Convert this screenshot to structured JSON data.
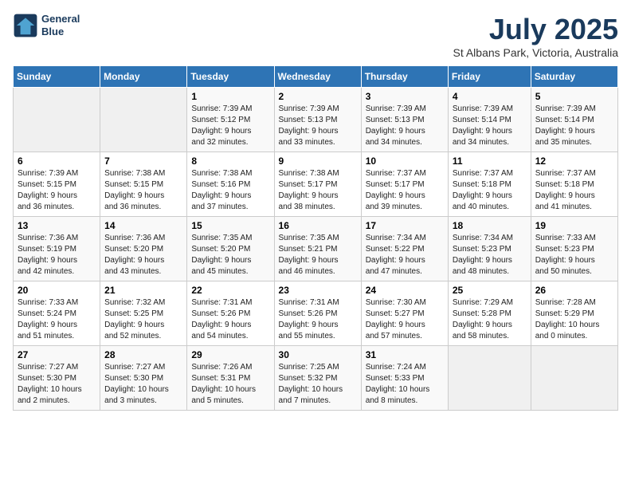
{
  "logo": {
    "line1": "General",
    "line2": "Blue"
  },
  "title": "July 2025",
  "subtitle": "St Albans Park, Victoria, Australia",
  "days_header": [
    "Sunday",
    "Monday",
    "Tuesday",
    "Wednesday",
    "Thursday",
    "Friday",
    "Saturday"
  ],
  "weeks": [
    [
      {
        "day": "",
        "content": ""
      },
      {
        "day": "",
        "content": ""
      },
      {
        "day": "1",
        "content": "Sunrise: 7:39 AM\nSunset: 5:12 PM\nDaylight: 9 hours\nand 32 minutes."
      },
      {
        "day": "2",
        "content": "Sunrise: 7:39 AM\nSunset: 5:13 PM\nDaylight: 9 hours\nand 33 minutes."
      },
      {
        "day": "3",
        "content": "Sunrise: 7:39 AM\nSunset: 5:13 PM\nDaylight: 9 hours\nand 34 minutes."
      },
      {
        "day": "4",
        "content": "Sunrise: 7:39 AM\nSunset: 5:14 PM\nDaylight: 9 hours\nand 34 minutes."
      },
      {
        "day": "5",
        "content": "Sunrise: 7:39 AM\nSunset: 5:14 PM\nDaylight: 9 hours\nand 35 minutes."
      }
    ],
    [
      {
        "day": "6",
        "content": "Sunrise: 7:39 AM\nSunset: 5:15 PM\nDaylight: 9 hours\nand 36 minutes."
      },
      {
        "day": "7",
        "content": "Sunrise: 7:38 AM\nSunset: 5:15 PM\nDaylight: 9 hours\nand 36 minutes."
      },
      {
        "day": "8",
        "content": "Sunrise: 7:38 AM\nSunset: 5:16 PM\nDaylight: 9 hours\nand 37 minutes."
      },
      {
        "day": "9",
        "content": "Sunrise: 7:38 AM\nSunset: 5:17 PM\nDaylight: 9 hours\nand 38 minutes."
      },
      {
        "day": "10",
        "content": "Sunrise: 7:37 AM\nSunset: 5:17 PM\nDaylight: 9 hours\nand 39 minutes."
      },
      {
        "day": "11",
        "content": "Sunrise: 7:37 AM\nSunset: 5:18 PM\nDaylight: 9 hours\nand 40 minutes."
      },
      {
        "day": "12",
        "content": "Sunrise: 7:37 AM\nSunset: 5:18 PM\nDaylight: 9 hours\nand 41 minutes."
      }
    ],
    [
      {
        "day": "13",
        "content": "Sunrise: 7:36 AM\nSunset: 5:19 PM\nDaylight: 9 hours\nand 42 minutes."
      },
      {
        "day": "14",
        "content": "Sunrise: 7:36 AM\nSunset: 5:20 PM\nDaylight: 9 hours\nand 43 minutes."
      },
      {
        "day": "15",
        "content": "Sunrise: 7:35 AM\nSunset: 5:20 PM\nDaylight: 9 hours\nand 45 minutes."
      },
      {
        "day": "16",
        "content": "Sunrise: 7:35 AM\nSunset: 5:21 PM\nDaylight: 9 hours\nand 46 minutes."
      },
      {
        "day": "17",
        "content": "Sunrise: 7:34 AM\nSunset: 5:22 PM\nDaylight: 9 hours\nand 47 minutes."
      },
      {
        "day": "18",
        "content": "Sunrise: 7:34 AM\nSunset: 5:23 PM\nDaylight: 9 hours\nand 48 minutes."
      },
      {
        "day": "19",
        "content": "Sunrise: 7:33 AM\nSunset: 5:23 PM\nDaylight: 9 hours\nand 50 minutes."
      }
    ],
    [
      {
        "day": "20",
        "content": "Sunrise: 7:33 AM\nSunset: 5:24 PM\nDaylight: 9 hours\nand 51 minutes."
      },
      {
        "day": "21",
        "content": "Sunrise: 7:32 AM\nSunset: 5:25 PM\nDaylight: 9 hours\nand 52 minutes."
      },
      {
        "day": "22",
        "content": "Sunrise: 7:31 AM\nSunset: 5:26 PM\nDaylight: 9 hours\nand 54 minutes."
      },
      {
        "day": "23",
        "content": "Sunrise: 7:31 AM\nSunset: 5:26 PM\nDaylight: 9 hours\nand 55 minutes."
      },
      {
        "day": "24",
        "content": "Sunrise: 7:30 AM\nSunset: 5:27 PM\nDaylight: 9 hours\nand 57 minutes."
      },
      {
        "day": "25",
        "content": "Sunrise: 7:29 AM\nSunset: 5:28 PM\nDaylight: 9 hours\nand 58 minutes."
      },
      {
        "day": "26",
        "content": "Sunrise: 7:28 AM\nSunset: 5:29 PM\nDaylight: 10 hours\nand 0 minutes."
      }
    ],
    [
      {
        "day": "27",
        "content": "Sunrise: 7:27 AM\nSunset: 5:30 PM\nDaylight: 10 hours\nand 2 minutes."
      },
      {
        "day": "28",
        "content": "Sunrise: 7:27 AM\nSunset: 5:30 PM\nDaylight: 10 hours\nand 3 minutes."
      },
      {
        "day": "29",
        "content": "Sunrise: 7:26 AM\nSunset: 5:31 PM\nDaylight: 10 hours\nand 5 minutes."
      },
      {
        "day": "30",
        "content": "Sunrise: 7:25 AM\nSunset: 5:32 PM\nDaylight: 10 hours\nand 7 minutes."
      },
      {
        "day": "31",
        "content": "Sunrise: 7:24 AM\nSunset: 5:33 PM\nDaylight: 10 hours\nand 8 minutes."
      },
      {
        "day": "",
        "content": ""
      },
      {
        "day": "",
        "content": ""
      }
    ]
  ]
}
